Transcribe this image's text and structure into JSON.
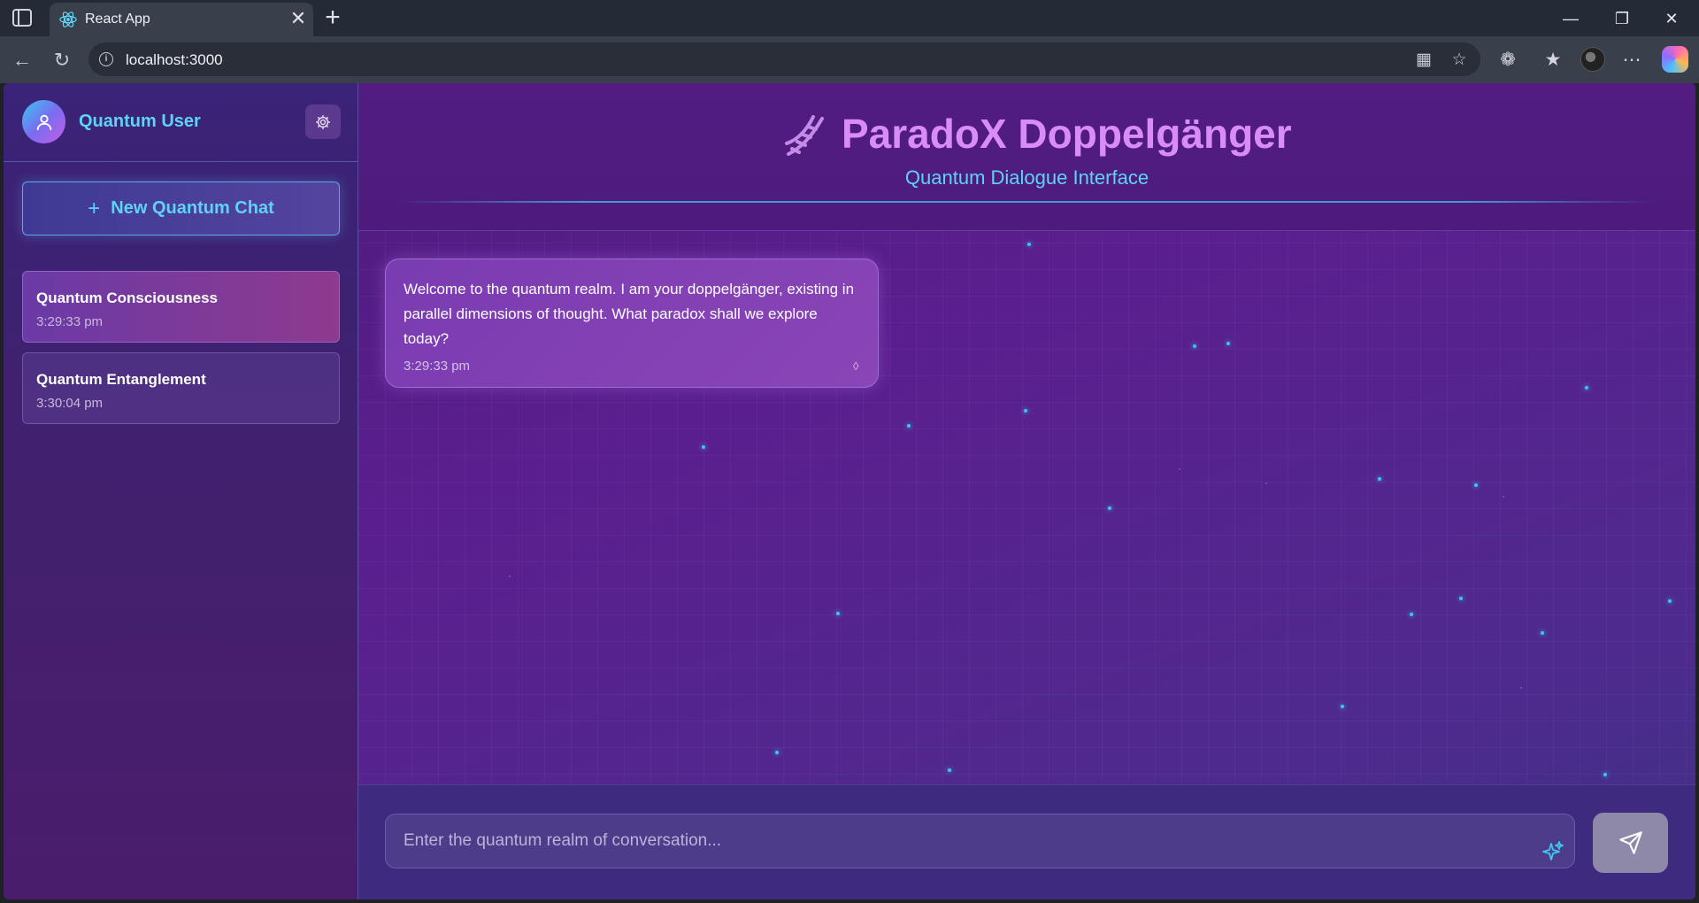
{
  "browser": {
    "tab_title": "React App",
    "url": "localhost:3000",
    "tab_close": "✕",
    "new_tab": "+",
    "window_controls": {
      "minimize": "—",
      "maximize": "❐",
      "close": "✕"
    }
  },
  "sidebar": {
    "user_name": "Quantum User",
    "new_chat_label": "New Quantum Chat",
    "new_chat_icon": "+",
    "chats": [
      {
        "title": "Quantum Consciousness",
        "time": "3:29:33 pm",
        "active": true
      },
      {
        "title": "Quantum Entanglement",
        "time": "3:30:04 pm",
        "active": false
      }
    ]
  },
  "header": {
    "title": "ParadoX Doppelgänger",
    "subtitle": "Quantum Dialogue Interface"
  },
  "messages": [
    {
      "text": "Welcome to the quantum realm. I am your doppelgänger, existing in parallel dimensions of thought. What paradox shall we explore today?",
      "time": "3:29:33 pm",
      "mark": "◊"
    }
  ],
  "composer": {
    "placeholder": "Enter the quantum realm of conversation..."
  },
  "icons": {
    "tab_favicon": "react-icon",
    "user": "user-icon",
    "settings": "gear-icon",
    "logo": "dna-icon",
    "sparkle": "sparkle-icon",
    "send": "send-icon"
  },
  "colors": {
    "accent_cyan": "#5ed3f5",
    "title_pink": "#d98cf5",
    "bubble": "#7a3cb2",
    "background": "#4a1b78"
  }
}
